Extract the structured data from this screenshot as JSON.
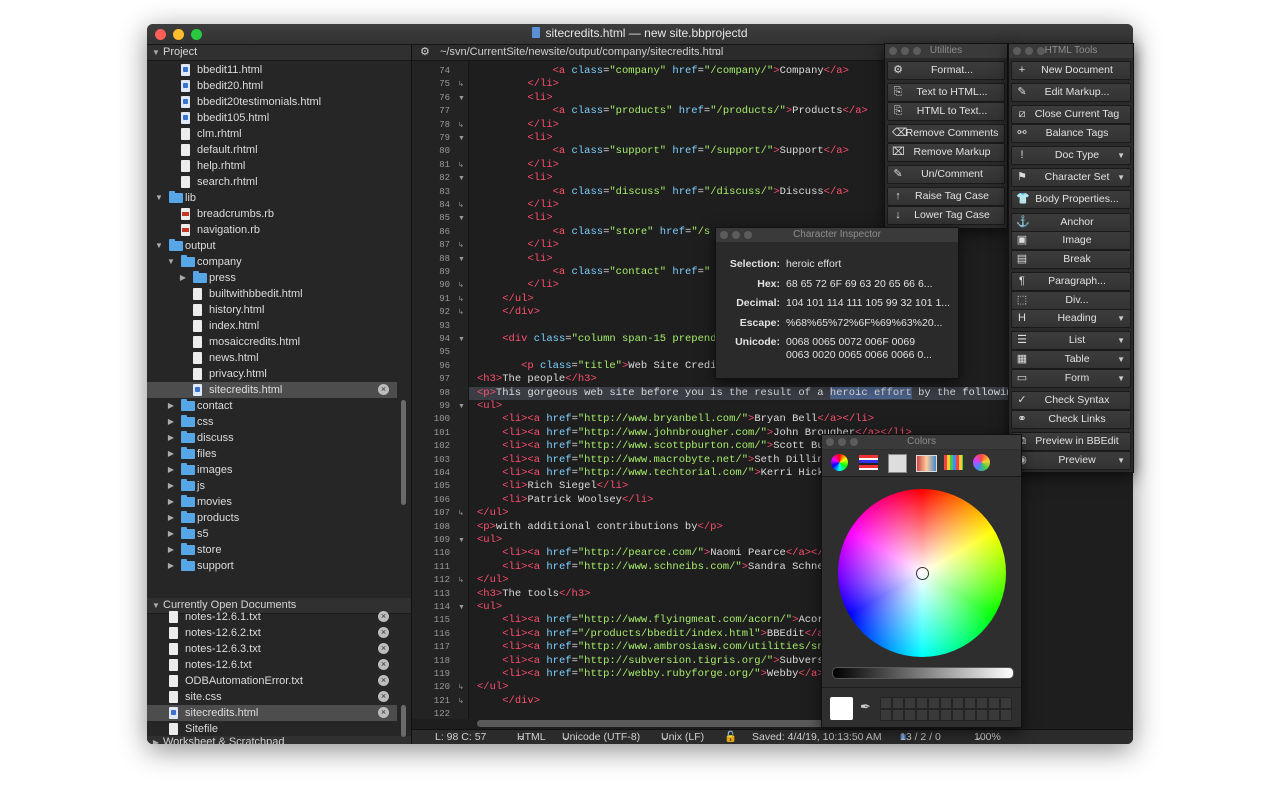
{
  "window": {
    "title": "sitecredits.html — new site.bbprojectd"
  },
  "colors": {
    "accent": "#4a5f86",
    "folder": "#57a7e8",
    "tag": "#ff4f6e",
    "attr": "#7fd0ff",
    "string": "#a6ec6a"
  },
  "sidebar": {
    "project_header": "Project",
    "project_items": [
      {
        "label": "bbedit11.html",
        "icon": "b"
      },
      {
        "label": "bbedit20.html",
        "icon": "b"
      },
      {
        "label": "bbedit20testimonials.html",
        "icon": "b"
      },
      {
        "label": "bbedit105.html",
        "icon": "b"
      },
      {
        "label": "clm.rhtml",
        "icon": "f"
      },
      {
        "label": "default.rhtml",
        "icon": "f"
      },
      {
        "label": "help.rhtml",
        "icon": "f"
      },
      {
        "label": "search.rhtml",
        "icon": "f"
      },
      {
        "label": "lib",
        "icon": "folder"
      },
      {
        "label": "breadcrumbs.rb",
        "icon": "r"
      },
      {
        "label": "navigation.rb",
        "icon": "r"
      },
      {
        "label": "output",
        "icon": "folder"
      },
      {
        "label": "company",
        "icon": "folder"
      },
      {
        "label": "press",
        "icon": "folder"
      },
      {
        "label": "builtwithbbedit.html",
        "icon": "f"
      },
      {
        "label": "history.html",
        "icon": "f"
      },
      {
        "label": "index.html",
        "icon": "f"
      },
      {
        "label": "mosaiccredits.html",
        "icon": "f"
      },
      {
        "label": "news.html",
        "icon": "f"
      },
      {
        "label": "privacy.html",
        "icon": "f"
      },
      {
        "label": "sitecredits.html",
        "icon": "b"
      },
      {
        "label": "contact",
        "icon": "folder"
      },
      {
        "label": "css",
        "icon": "folder"
      },
      {
        "label": "discuss",
        "icon": "folder"
      },
      {
        "label": "files",
        "icon": "folder"
      },
      {
        "label": "images",
        "icon": "folder"
      },
      {
        "label": "js",
        "icon": "folder"
      },
      {
        "label": "movies",
        "icon": "folder"
      },
      {
        "label": "products",
        "icon": "folder"
      },
      {
        "label": "s5",
        "icon": "folder"
      },
      {
        "label": "store",
        "icon": "folder"
      },
      {
        "label": "support",
        "icon": "folder"
      }
    ],
    "open_header": "Currently Open Documents",
    "open_items": [
      "notes-12.6.1.txt",
      "notes-12.6.2.txt",
      "notes-12.6.3.txt",
      "notes-12.6.txt",
      "ODBAutomationError.txt",
      "site.css",
      "sitecredits.html",
      "Sitefile"
    ],
    "worksheet_header": "Worksheet & Scratchpad"
  },
  "editor": {
    "path": "~/svn/CurrentSite/newsite/output/company/sitecredits.html",
    "lines": [
      {
        "n": "74",
        "html": "            <span class=\"t\">&lt;a</span> <span class=\"a\">class</span>=<span class=\"s\">\"company\"</span> <span class=\"a\">href</span>=<span class=\"s\">\"/company/\"</span><span class=\"t\">&gt;</span>Company<span class=\"t\">&lt;/a&gt;</span>"
      },
      {
        "n": "75",
        "html": "        <span class=\"t\">&lt;/li&gt;</span>"
      },
      {
        "n": "76",
        "html": "        <span class=\"t\">&lt;li&gt;</span>"
      },
      {
        "n": "77",
        "html": "            <span class=\"t\">&lt;a</span> <span class=\"a\">class</span>=<span class=\"s\">\"products\"</span> <span class=\"a\">href</span>=<span class=\"s\">\"/products/\"</span><span class=\"t\">&gt;</span>Products<span class=\"t\">&lt;/a&gt;</span>"
      },
      {
        "n": "78",
        "html": "        <span class=\"t\">&lt;/li&gt;</span>"
      },
      {
        "n": "79",
        "html": "        <span class=\"t\">&lt;li&gt;</span>"
      },
      {
        "n": "80",
        "html": "            <span class=\"t\">&lt;a</span> <span class=\"a\">class</span>=<span class=\"s\">\"support\"</span> <span class=\"a\">href</span>=<span class=\"s\">\"/support/\"</span><span class=\"t\">&gt;</span>Support<span class=\"t\">&lt;/a&gt;</span>"
      },
      {
        "n": "81",
        "html": "        <span class=\"t\">&lt;/li&gt;</span>"
      },
      {
        "n": "82",
        "html": "        <span class=\"t\">&lt;li&gt;</span>"
      },
      {
        "n": "83",
        "html": "            <span class=\"t\">&lt;a</span> <span class=\"a\">class</span>=<span class=\"s\">\"discuss\"</span> <span class=\"a\">href</span>=<span class=\"s\">\"/discuss/\"</span><span class=\"t\">&gt;</span>Discuss<span class=\"t\">&lt;/a&gt;</span>"
      },
      {
        "n": "84",
        "html": "        <span class=\"t\">&lt;/li&gt;</span>"
      },
      {
        "n": "85",
        "html": "        <span class=\"t\">&lt;li&gt;</span>"
      },
      {
        "n": "86",
        "html": "            <span class=\"t\">&lt;a</span> <span class=\"a\">class</span>=<span class=\"s\">\"store\"</span> <span class=\"a\">href</span>=<span class=\"s\">\"/s</span>"
      },
      {
        "n": "87",
        "html": "        <span class=\"t\">&lt;/li&gt;</span>"
      },
      {
        "n": "88",
        "html": "        <span class=\"t\">&lt;li&gt;</span>"
      },
      {
        "n": "89",
        "html": "            <span class=\"t\">&lt;a</span> <span class=\"a\">class</span>=<span class=\"s\">\"contact\"</span> <span class=\"a\">href</span>=<span class=\"s\">\"</span>"
      },
      {
        "n": "90",
        "html": "        <span class=\"t\">&lt;/li&gt;</span>"
      },
      {
        "n": "91",
        "html": "    <span class=\"t\">&lt;/ul&gt;</span>"
      },
      {
        "n": "92",
        "html": "    <span class=\"t\">&lt;/div&gt;</span>"
      },
      {
        "n": "93",
        "html": ""
      },
      {
        "n": "94",
        "html": "    <span class=\"t\">&lt;div</span> <span class=\"a\">class</span>=<span class=\"s\">\"column span-15 prepend-2 f</span>"
      },
      {
        "n": "95",
        "html": ""
      },
      {
        "n": "96",
        "html": "       <span class=\"t\">&lt;p</span> <span class=\"a\">class</span>=<span class=\"s\">\"title\"</span><span class=\"t\">&gt;</span>Web Site Credits<span class=\"t\">&lt;/</span>"
      },
      {
        "n": "97",
        "html": "<span class=\"t\">&lt;h3&gt;</span>The people<span class=\"t\">&lt;/h3&gt;</span>"
      },
      {
        "n": "98",
        "html": "<span class=\"t\">&lt;p&gt;</span>This gorgeous web site before you is the result of a <span class=\"sel\">heroic effort</span> by the following indiv",
        "hl": true
      },
      {
        "n": "99",
        "html": "<span class=\"t\">&lt;ul&gt;</span>"
      },
      {
        "n": "100",
        "html": "    <span class=\"t\">&lt;li&gt;&lt;a</span> <span class=\"a\">href</span>=<span class=\"s\">\"http://www.bryanbell.com/\"</span><span class=\"t\">&gt;</span>Bryan Bell<span class=\"t\">&lt;/a&gt;&lt;/li&gt;</span>"
      },
      {
        "n": "101",
        "html": "    <span class=\"t\">&lt;li&gt;&lt;a</span> <span class=\"a\">href</span>=<span class=\"s\">\"http://www.johnbrougher.com/\"</span><span class=\"t\">&gt;</span>John Brougher<span class=\"t\">&lt;/a&gt;&lt;/li&gt;</span>"
      },
      {
        "n": "102",
        "html": "    <span class=\"t\">&lt;li&gt;&lt;a</span> <span class=\"a\">href</span>=<span class=\"s\">\"http://www.scottpburton.com/\"</span><span class=\"t\">&gt;</span>Scott Burton-"
      },
      {
        "n": "103",
        "html": "    <span class=\"t\">&lt;li&gt;&lt;a</span> <span class=\"a\">href</span>=<span class=\"s\">\"http://www.macrobyte.net/\"</span><span class=\"t\">&gt;</span>Seth Dillingham"
      },
      {
        "n": "104",
        "html": "    <span class=\"t\">&lt;li&gt;&lt;a</span> <span class=\"a\">href</span>=<span class=\"s\">\"http://www.techtorial.com/\"</span><span class=\"t\">&gt;</span>Kerri Hicks<span class=\"t\">&lt;/a&gt;</span>"
      },
      {
        "n": "105",
        "html": "    <span class=\"t\">&lt;li&gt;</span>Rich Siegel<span class=\"t\">&lt;/li&gt;</span>"
      },
      {
        "n": "106",
        "html": "    <span class=\"t\">&lt;li&gt;</span>Patrick Woolsey<span class=\"t\">&lt;/li&gt;</span>"
      },
      {
        "n": "107",
        "html": "<span class=\"t\">&lt;/ul&gt;</span>"
      },
      {
        "n": "108",
        "html": "<span class=\"t\">&lt;p&gt;</span>with additional contributions by<span class=\"t\">&lt;/p&gt;</span>"
      },
      {
        "n": "109",
        "html": "<span class=\"t\">&lt;ul&gt;</span>"
      },
      {
        "n": "110",
        "html": "    <span class=\"t\">&lt;li&gt;&lt;a</span> <span class=\"a\">href</span>=<span class=\"s\">\"http://pearce.com/\"</span><span class=\"t\">&gt;</span>Naomi Pearce<span class=\"t\">&lt;/a&gt;&lt;/li&gt;</span>"
      },
      {
        "n": "111",
        "html": "    <span class=\"t\">&lt;li&gt;&lt;a</span> <span class=\"a\">href</span>=<span class=\"s\">\"http://www.schneibs.com/\"</span><span class=\"t\">&gt;</span>Sandra Schneible-"
      },
      {
        "n": "112",
        "html": "<span class=\"t\">&lt;/ul&gt;</span>"
      },
      {
        "n": "113",
        "html": "<span class=\"t\">&lt;h3&gt;</span>The tools<span class=\"t\">&lt;/h3&gt;</span>"
      },
      {
        "n": "114",
        "html": "<span class=\"t\">&lt;ul&gt;</span>"
      },
      {
        "n": "115",
        "html": "    <span class=\"t\">&lt;li&gt;&lt;a</span> <span class=\"a\">href</span>=<span class=\"s\">\"http://www.flyingmeat.com/acorn/\"</span><span class=\"t\">&gt;</span>Acorn<span class=\"t\">&lt;/a&gt;</span>"
      },
      {
        "n": "116",
        "html": "    <span class=\"t\">&lt;li&gt;&lt;a</span> <span class=\"a\">href</span>=<span class=\"s\">\"/products/bbedit/index.html\"</span><span class=\"t\">&gt;</span>BBEdit<span class=\"t\">&lt;/a&gt;&lt;/li</span>"
      },
      {
        "n": "117",
        "html": "    <span class=\"t\">&lt;li&gt;&lt;a</span> <span class=\"a\">href</span>=<span class=\"s\">\"http://www.ambrosiasw.com/utilities/snapzpr</span>"
      },
      {
        "n": "118",
        "html": "    <span class=\"t\">&lt;li&gt;&lt;a</span> <span class=\"a\">href</span>=<span class=\"s\">\"http://subversion.tigris.org/\"</span><span class=\"t\">&gt;</span>Subversion<span class=\"t\">&lt;</span>"
      },
      {
        "n": "119",
        "html": "    <span class=\"t\">&lt;li&gt;&lt;a</span> <span class=\"a\">href</span>=<span class=\"s\">\"http://webby.rubyforge.org/\"</span><span class=\"t\">&gt;</span>Webby<span class=\"t\">&lt;/a&gt;&lt;/li</span>"
      },
      {
        "n": "120",
        "html": "<span class=\"t\">&lt;/ul&gt;</span>"
      },
      {
        "n": "121",
        "html": "    <span class=\"t\">&lt;/div&gt;</span>"
      },
      {
        "n": "122",
        "html": ""
      }
    ]
  },
  "status": {
    "position": "L: 98 C: 57",
    "language": "HTML",
    "encoding": "Unicode (UTF-8)",
    "line_endings": "Unix (LF)",
    "saved": "Saved: 4/4/19, 10:13:50 AM",
    "counts": "13 / 2 / 0",
    "zoom": "100%"
  },
  "utilities": {
    "title": "Utilities",
    "buttons": [
      "Format...",
      "Text to HTML...",
      "HTML to Text...",
      "Remove Comments",
      "Remove Markup",
      "Un/Comment",
      "Raise Tag Case",
      "Lower Tag Case"
    ]
  },
  "html_tools": {
    "title": "HTML Tools",
    "buttons": [
      "New Document",
      "Edit Markup...",
      "Close Current Tag",
      "Balance Tags",
      "Doc Type",
      "Character Set",
      "Body Properties...",
      "Anchor",
      "Image",
      "Break",
      "Paragraph...",
      "Div...",
      "Heading",
      "List",
      "Table",
      "Form",
      "Check Syntax",
      "Check Links",
      "Preview in BBEdit",
      "Preview"
    ]
  },
  "char_inspector": {
    "title": "Character Inspector",
    "rows": [
      {
        "k": "Selection:",
        "v": "heroic effort"
      },
      {
        "k": "Hex:",
        "v": "68 65 72 6F 69 63 20 65 66 6..."
      },
      {
        "k": "Decimal:",
        "v": "104 101 114 111 105 99 32 101 1..."
      },
      {
        "k": "Escape:",
        "v": "%68%65%72%6F%69%63%20..."
      },
      {
        "k": "Unicode:",
        "v": "0068 0065 0072 006F 0069",
        "v2": "0063 0020 0065 0066 0066 0..."
      }
    ]
  },
  "colors_panel": {
    "title": "Colors"
  }
}
